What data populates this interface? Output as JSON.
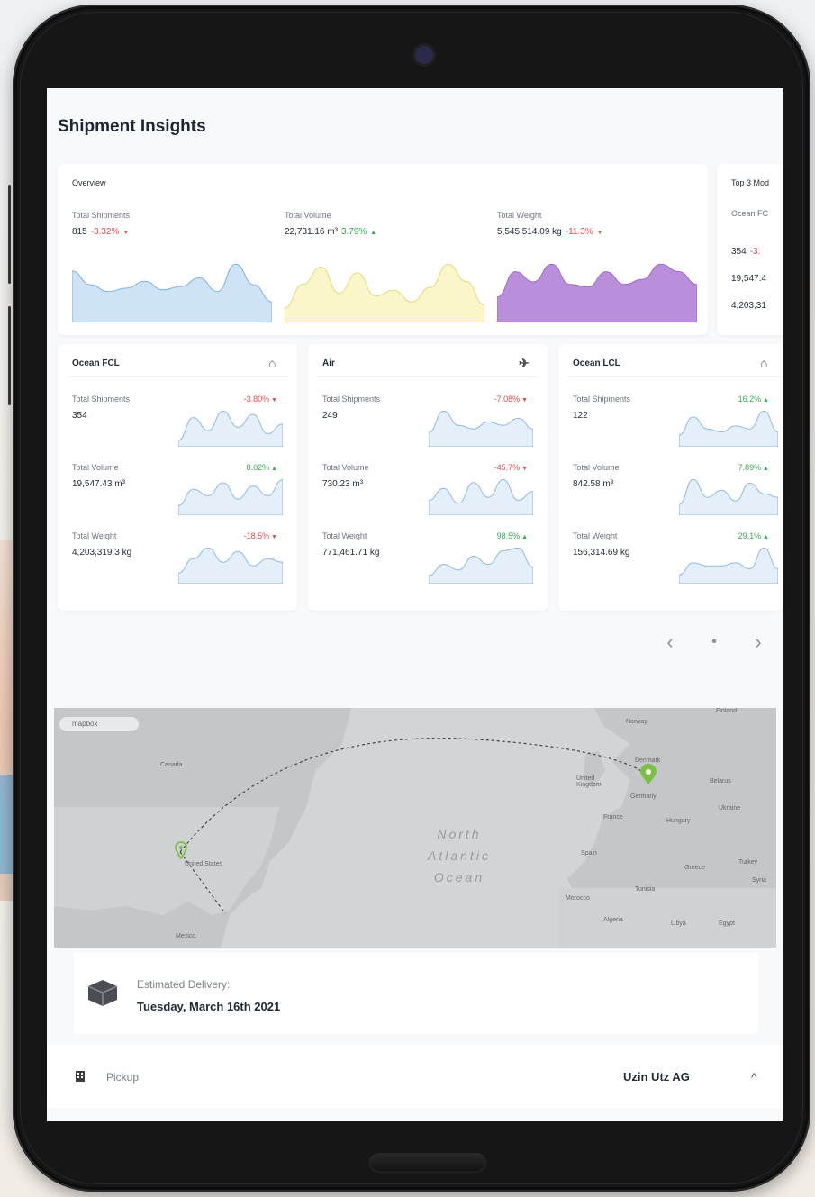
{
  "page_title": "Shipment Insights",
  "overview": {
    "title": "Overview",
    "metrics": [
      {
        "label": "Total Shipments",
        "value": "815",
        "change": "-3.32%",
        "trend": "down",
        "color": "#cfe3f7",
        "stroke": "#7fb0e0",
        "spark": [
          30,
          22,
          18,
          20,
          24,
          19,
          21,
          26,
          18,
          34,
          22,
          12
        ]
      },
      {
        "label": "Total Volume",
        "value": "22,731.16 m³",
        "change": "3.79%",
        "trend": "up",
        "color": "#fbf6c9",
        "stroke": "#e6d97a",
        "spark": [
          10,
          26,
          38,
          20,
          34,
          18,
          22,
          14,
          24,
          40,
          28,
          12
        ]
      },
      {
        "label": "Total Weight",
        "value": "5,545,514.09 kg",
        "change": "-11.3%",
        "trend": "down",
        "color": "#b98fdc",
        "stroke": "#9a6cc6",
        "spark": [
          20,
          40,
          32,
          46,
          30,
          28,
          40,
          30,
          34,
          46,
          40,
          30
        ]
      }
    ]
  },
  "top3": {
    "title": "Top 3 Mod",
    "sub": "Ocean FC",
    "v1": "354",
    "v1_change": "-3.",
    "v2": "19,547.4",
    "v3": "4,203,31"
  },
  "mode_cards": [
    {
      "title": "Ocean FCL",
      "icon": "container-icon",
      "rows": [
        {
          "label": "Total Shipments",
          "value": "354",
          "change": "-3.80%",
          "trend": "down",
          "spark": [
            4,
            18,
            10,
            22,
            12,
            20,
            8,
            14
          ]
        },
        {
          "label": "Total Volume",
          "value": "19,547.43 m³",
          "change": "8.02%",
          "trend": "up",
          "spark": [
            6,
            16,
            12,
            20,
            10,
            18,
            12,
            22
          ]
        },
        {
          "label": "Total Weight",
          "value": "4,203,319.3 kg",
          "change": "-18.5%",
          "trend": "down",
          "spark": [
            6,
            14,
            20,
            12,
            18,
            10,
            14,
            12
          ]
        }
      ]
    },
    {
      "title": "Air",
      "icon": "airplane-icon",
      "rows": [
        {
          "label": "Total Shipments",
          "value": "249",
          "change": "-7.08%",
          "trend": "down",
          "spark": [
            8,
            20,
            12,
            10,
            14,
            12,
            16,
            10
          ]
        },
        {
          "label": "Total Volume",
          "value": "730.23 m³",
          "change": "-45.7%",
          "trend": "down",
          "spark": [
            10,
            18,
            8,
            22,
            12,
            24,
            10,
            16
          ]
        },
        {
          "label": "Total Weight",
          "value": "771,461.71 kg",
          "change": "98.5%",
          "trend": "up",
          "spark": [
            6,
            14,
            10,
            20,
            14,
            24,
            26,
            12
          ]
        }
      ]
    },
    {
      "title": "Ocean LCL",
      "icon": "container-icon",
      "rows": [
        {
          "label": "Total Shipments",
          "value": "122",
          "change": "16.2%",
          "trend": "up",
          "spark": [
            8,
            20,
            12,
            10,
            14,
            12,
            24,
            10
          ]
        },
        {
          "label": "Total Volume",
          "value": "842.58 m³",
          "change": "7.89%",
          "trend": "up",
          "spark": [
            6,
            20,
            10,
            14,
            8,
            18,
            12,
            10
          ]
        },
        {
          "label": "Total Weight",
          "value": "156,314.69 kg",
          "change": "29.1%",
          "trend": "up",
          "spark": [
            6,
            14,
            12,
            12,
            14,
            10,
            24,
            10
          ]
        }
      ]
    }
  ],
  "pager": {
    "prev": "‹",
    "dot": "•",
    "next": "›"
  },
  "map": {
    "attribution": "mapbox",
    "labels": {
      "canada": "Canada",
      "us": "United States",
      "mexico": "Mexico",
      "norway": "Norway",
      "uk": "United Kingdom",
      "germany": "Germany",
      "france": "France",
      "spain": "Spain",
      "morocco": "Morocco",
      "algeria": "Algeria",
      "libya": "Libya",
      "egypt": "Egypt",
      "tunisia": "Tunisia",
      "belarus": "Belarus",
      "ukraine": "Ukraine",
      "hungary": "Hungary",
      "turkey": "Turkey",
      "greece": "Greece",
      "syria": "Syria",
      "finland": "Finland",
      "denmark": "Denmark"
    },
    "ocean": [
      "North",
      "Atlantic",
      "Ocean"
    ],
    "marker_color": "#7ac143"
  },
  "delivery": {
    "label": "Estimated Delivery:",
    "date": "Tuesday, March 16th 2021"
  },
  "pickup": {
    "label": "Pickup",
    "company": "Uzin Utz AG",
    "chevron": "^"
  }
}
